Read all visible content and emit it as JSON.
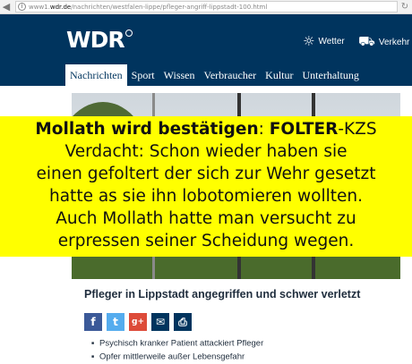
{
  "browser": {
    "back_icon": "back-arrow-icon",
    "forward_icon": "forward-arrow-icon",
    "url_prefix": "www1.",
    "url_domain": "wdr.de",
    "url_path": "/nachrichten/westfalen-lippe/pfleger-angriff-lippstadt-100.html",
    "reload_icon": "reload-icon"
  },
  "header": {
    "logo": "WDR",
    "weather_label": "Wetter",
    "traffic_label": "Verkehr"
  },
  "nav": {
    "tabs": [
      {
        "label": "Nachrichten",
        "active": true
      },
      {
        "label": "Sport"
      },
      {
        "label": "Wissen"
      },
      {
        "label": "Verbraucher"
      },
      {
        "label": "Kultur"
      },
      {
        "label": "Unterhaltung"
      }
    ]
  },
  "overlay": {
    "line1_bold": "Mollath wird bestätigen",
    "line1_colon": ": ",
    "line1_bold2": "FOLTER",
    "line1_rest": "-KZS",
    "line2": "Verdacht: Schon wieder haben sie",
    "line3": "einen gefoltert der sich zur  Wehr gesetzt",
    "line4": "hatte as sie ihn lobotomieren wollten.",
    "line5": "Auch Mollath hatte man versucht zu",
    "line6": "erpressen seiner Scheidung wegen."
  },
  "article": {
    "headline": "Pfleger in Lippstadt angegriffen und schwer verletzt",
    "share": {
      "facebook": "f",
      "twitter": "t",
      "googleplus": "g+",
      "mail": "✉",
      "print": "⎙"
    },
    "bullets": [
      "Psychisch kranker Patient attackiert Pfleger",
      "Opfer mittlerweile außer Lebensgefahr"
    ]
  },
  "colors": {
    "header_bg": "#00345e",
    "overlay_bg": "#ffff00"
  }
}
